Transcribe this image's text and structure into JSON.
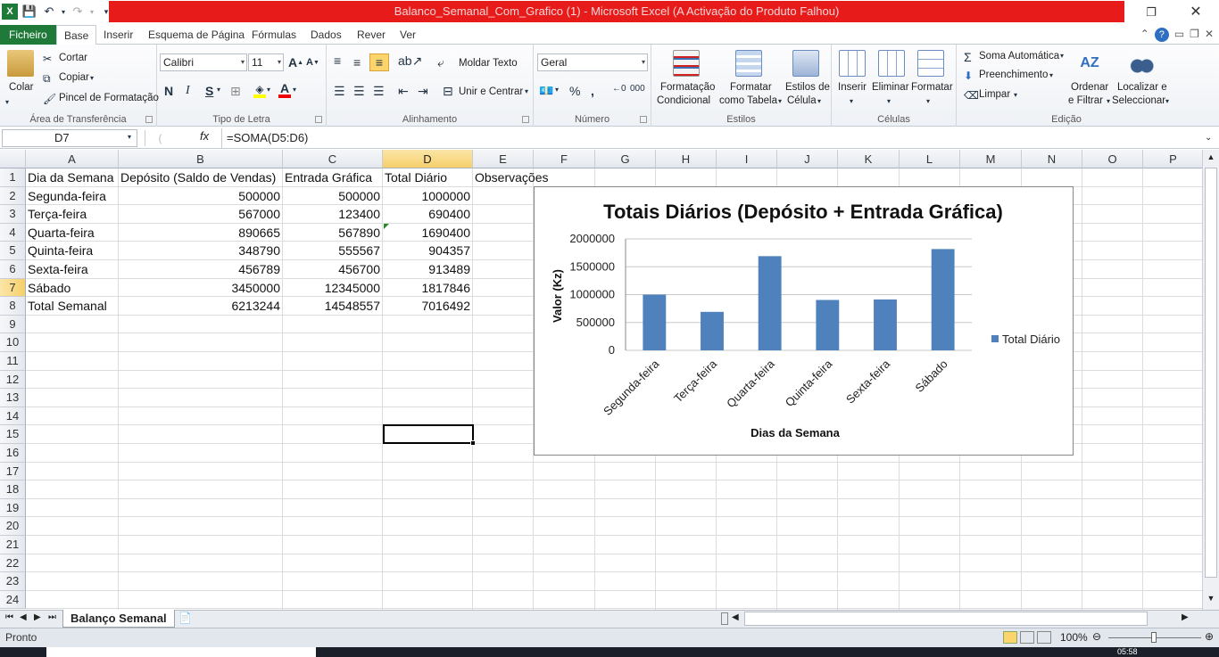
{
  "window": {
    "title": "Balanco_Semanal_Com_Grafico (1)  -  Microsoft Excel (A Activação do Produto Falhou)"
  },
  "tabs": [
    "Ficheiro",
    "Base",
    "Inserir",
    "Esquema de Página",
    "Fórmulas",
    "Dados",
    "Rever",
    "Ver"
  ],
  "ribbon": {
    "clipboard": {
      "label": "Área de Transferência",
      "paste": "Colar",
      "cut": "Cortar",
      "copy": "Copiar",
      "format_painter": "Pincel de Formatação"
    },
    "font": {
      "label": "Tipo de Letra",
      "name": "Calibri",
      "size": "11"
    },
    "alignment": {
      "label": "Alinhamento",
      "wrap": "Moldar Texto",
      "merge": "Unir e Centrar"
    },
    "number": {
      "label": "Número",
      "format": "Geral",
      "percent": "%",
      "thousands": "000"
    },
    "styles": {
      "label": "Estilos",
      "conditional_1": "Formatação",
      "conditional_2": "Condicional",
      "table_1": "Formatar",
      "table_2": "como Tabela",
      "cell_1": "Estilos de",
      "cell_2": "Célula"
    },
    "cells": {
      "label": "Células",
      "insert": "Inserir",
      "delete": "Eliminar",
      "format": "Formatar"
    },
    "editing": {
      "label": "Edição",
      "autosum": "Soma Automática",
      "fill": "Preenchimento",
      "clear": "Limpar",
      "sort_1": "Ordenar",
      "sort_2": "e Filtrar",
      "find_1": "Localizar e",
      "find_2": "Seleccionar"
    }
  },
  "formula_bar": {
    "name_box": "D7",
    "fx": "fx",
    "formula": "=SOMA(D5:D6)"
  },
  "columns": [
    "A",
    "B",
    "C",
    "D",
    "E",
    "F",
    "G",
    "H",
    "I",
    "J",
    "K",
    "L",
    "M",
    "N",
    "O",
    "P"
  ],
  "rows": [
    "1",
    "2",
    "3",
    "4",
    "5",
    "6",
    "7",
    "8",
    "9",
    "10",
    "11",
    "12",
    "13",
    "14",
    "15",
    "16",
    "17",
    "18",
    "19",
    "20",
    "21",
    "22",
    "23",
    "24"
  ],
  "sheet": {
    "header": [
      "Dia da Semana",
      "Depósito (Saldo de Vendas)",
      "Entrada Gráfica",
      "Total Diário",
      "Observações"
    ],
    "data": [
      [
        "Segunda-feira",
        "500000",
        "500000",
        "1000000"
      ],
      [
        "Terça-feira",
        "567000",
        "123400",
        "690400"
      ],
      [
        "Quarta-feira",
        "890665",
        "567890",
        "1690400"
      ],
      [
        "Quinta-feira",
        "348790",
        "555567",
        "904357"
      ],
      [
        "Sexta-feira",
        "456789",
        "456700",
        "913489"
      ],
      [
        "Sábado",
        "3450000",
        "12345000",
        "1817846"
      ],
      [
        "Total Semanal",
        "6213244",
        "14548557",
        "7016492"
      ]
    ]
  },
  "chart_data": {
    "type": "bar",
    "title": "Totais Diários (Depósito + Entrada Gráfica)",
    "xlabel": "Dias da Semana",
    "ylabel": "Valor (Kz)",
    "categories": [
      "Segunda-feira",
      "Terça-feira",
      "Quarta-feira",
      "Quinta-feira",
      "Sexta-feira",
      "Sábado"
    ],
    "series": [
      {
        "name": "Total Diário",
        "values": [
          1000000,
          690400,
          1690400,
          904357,
          913489,
          1817846
        ],
        "color": "#4f81bd"
      }
    ],
    "ylim": [
      0,
      2000000
    ],
    "yticks": [
      "0",
      "500000",
      "1000000",
      "1500000",
      "2000000"
    ],
    "legend": "right",
    "grid": true
  },
  "sheet_tabs": {
    "active": "Balanço Semanal"
  },
  "status": {
    "mode": "Pronto",
    "zoom": "100%",
    "clock": "05:58"
  }
}
